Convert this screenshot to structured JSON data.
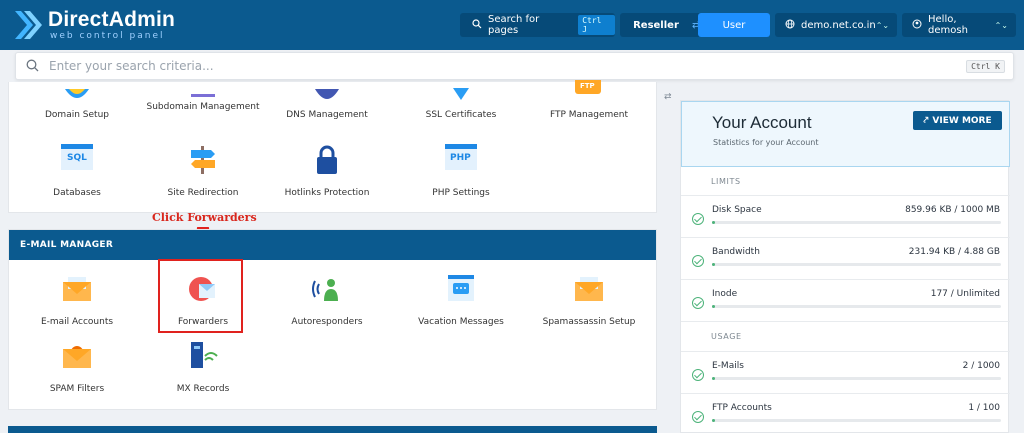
{
  "header": {
    "brand": "DirectAdmin",
    "brand_sub": "web control panel",
    "search_label": "Search for pages",
    "search_kbd": "Ctrl J",
    "role_reseller": "Reseller",
    "role_user": "User",
    "domain": "demo.net.co.in",
    "hello": "Hello, demosh"
  },
  "search": {
    "placeholder": "Enter your search criteria...",
    "kbd": "Ctrl K"
  },
  "top_section": {
    "row1": [
      "Domain Setup",
      "Subdomain Management",
      "DNS Management",
      "SSL Certificates",
      "FTP Management"
    ],
    "row2": [
      "Databases",
      "Site Redirection",
      "Hotlinks Protection",
      "PHP Settings"
    ],
    "icon_text": {
      "sql": "SQL",
      "php": "PHP",
      "ftp": "FTP"
    }
  },
  "annotation": {
    "text": "Click Forwarders"
  },
  "email_section": {
    "title": "E-MAIL MANAGER",
    "row1": [
      "E-mail Accounts",
      "Forwarders",
      "Autoresponders",
      "Vacation Messages",
      "Spamassassin Setup"
    ],
    "row2": [
      "SPAM Filters",
      "MX Records"
    ]
  },
  "account": {
    "title": "Your Account",
    "subtitle": "Statistics for your Account",
    "view_more": "VIEW MORE",
    "limits_label": "LIMITS",
    "usage_label": "USAGE",
    "limits": [
      {
        "label": "Disk Space",
        "value": "859.96 KB / 1000 MB",
        "fraction": 0.01
      },
      {
        "label": "Bandwidth",
        "value": "231.94 KB / 4.88 GB",
        "fraction": 0.01
      },
      {
        "label": "Inode",
        "value": "177 / Unlimited",
        "fraction": 0.01
      }
    ],
    "usage": [
      {
        "label": "E-Mails",
        "value": "2 / 1000",
        "fraction": 0.01
      },
      {
        "label": "FTP Accounts",
        "value": "1 / 100",
        "fraction": 0.01
      }
    ]
  },
  "colors": {
    "brand_blue": "#0b5a8f",
    "accent_blue": "#1e90ff",
    "annotation_red": "#e0221e",
    "success_green": "#4db37a"
  }
}
